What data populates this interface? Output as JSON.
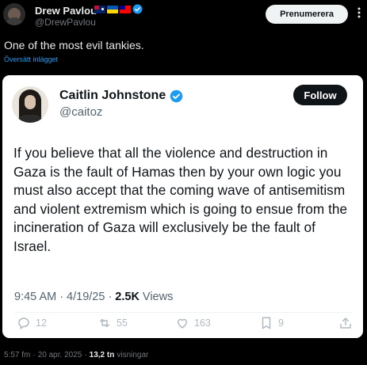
{
  "post": {
    "author_name": "Drew Pavlou",
    "author_handle": "@DrewPavlou",
    "subscribe_label": "Prenumerera",
    "text": "One of the most evil tankies.",
    "translate_label": "Översätt inlägget",
    "time": "5:57 fm",
    "date": "20 apr. 2025",
    "sep": "·",
    "views_count": "13,2 tn",
    "views_label": "visningar"
  },
  "quote": {
    "author_name": "Caitlin Johnstone",
    "author_handle": "@caitoz",
    "follow_label": "Follow",
    "body": "If you believe that all the violence and destruction in Gaza is the fault of Hamas then by your own logic you must also accept that the coming wave of antisemitism and violent extremism which is going to ensue from the incineration of Gaza will exclusively be the fault of Israel.",
    "time": "9:45 AM",
    "date": "4/19/25",
    "sep": "·",
    "views_count": "2.5K",
    "views_label": "Views",
    "actions": {
      "replies": "12",
      "reposts": "55",
      "likes": "163",
      "bookmarks": "9"
    }
  },
  "colors": {
    "background": "#000000",
    "card": "#ffffff",
    "accent": "#1d9bf0",
    "verified": "#1d9bf0"
  }
}
